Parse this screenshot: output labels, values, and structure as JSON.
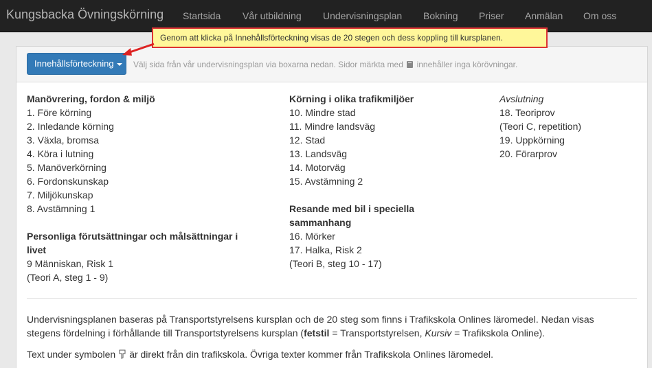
{
  "brand": "Kungsbacka Övningskörning",
  "nav": [
    "Startsida",
    "Vår utbildning",
    "Undervisningsplan",
    "Bokning",
    "Priser",
    "Anmälan",
    "Om oss"
  ],
  "toc_button": "Innehållsförteckning",
  "hint_before": "Välj sida från vår undervisningsplan via boxarna nedan. Sidor märkta med",
  "hint_after": "innehåller inga körövningar.",
  "callout": "Genom att klicka på Innehållsförteckning visas de 20 stegen och dess koppling till kursplanen.",
  "col1": {
    "heading1": "Manövrering, fordon & miljö",
    "items1": [
      "1. Före körning",
      "2. Inledande körning",
      "3. Växla, bromsa",
      "4. Köra i lutning",
      "5. Manöverkörning",
      "6. Fordonskunskap",
      "7. Miljökunskap",
      "8. Avstämning 1"
    ],
    "heading2_line1": "Personliga förutsättningar och målsättningar i",
    "heading2_line2": "livet",
    "items2": [
      "9 Människan, Risk 1",
      "(Teori A, steg 1 - 9)"
    ]
  },
  "col2": {
    "heading1": "Körning i olika trafikmiljöer",
    "items1": [
      "10. Mindre stad",
      "11. Mindre landsväg",
      "12. Stad",
      "13. Landsväg",
      "14. Motorväg",
      "15. Avstämning 2"
    ],
    "heading2_line1": "Resande med bil i speciella",
    "heading2_line2": "sammanhang",
    "items2": [
      "16. Mörker",
      "17. Halka, Risk 2",
      "(Teori B, steg 10 - 17)"
    ]
  },
  "col3": {
    "heading": "Avslutning",
    "items": [
      "18. Teoriprov",
      "(Teori C, repetition)",
      "19. Uppkörning",
      "20. Förarprov"
    ]
  },
  "para1": {
    "line1": "Undervisningsplanen baseras på Transportstyrelsens kursplan och de 20 steg som finns i Trafikskola Onlines läromedel. Nedan visas",
    "line2_start": "stegens fördelning i förhållande till Transportstyrelsens kursplan (",
    "bold": "fetstil",
    "mid": " = Transportstyrelsen, ",
    "italic": "Kursiv",
    "end": " = Trafikskola Online)."
  },
  "para2": {
    "before": "Text under symbolen",
    "after": "är direkt från din trafikskola. Övriga texter kommer från Trafikskola Onlines läromedel."
  }
}
